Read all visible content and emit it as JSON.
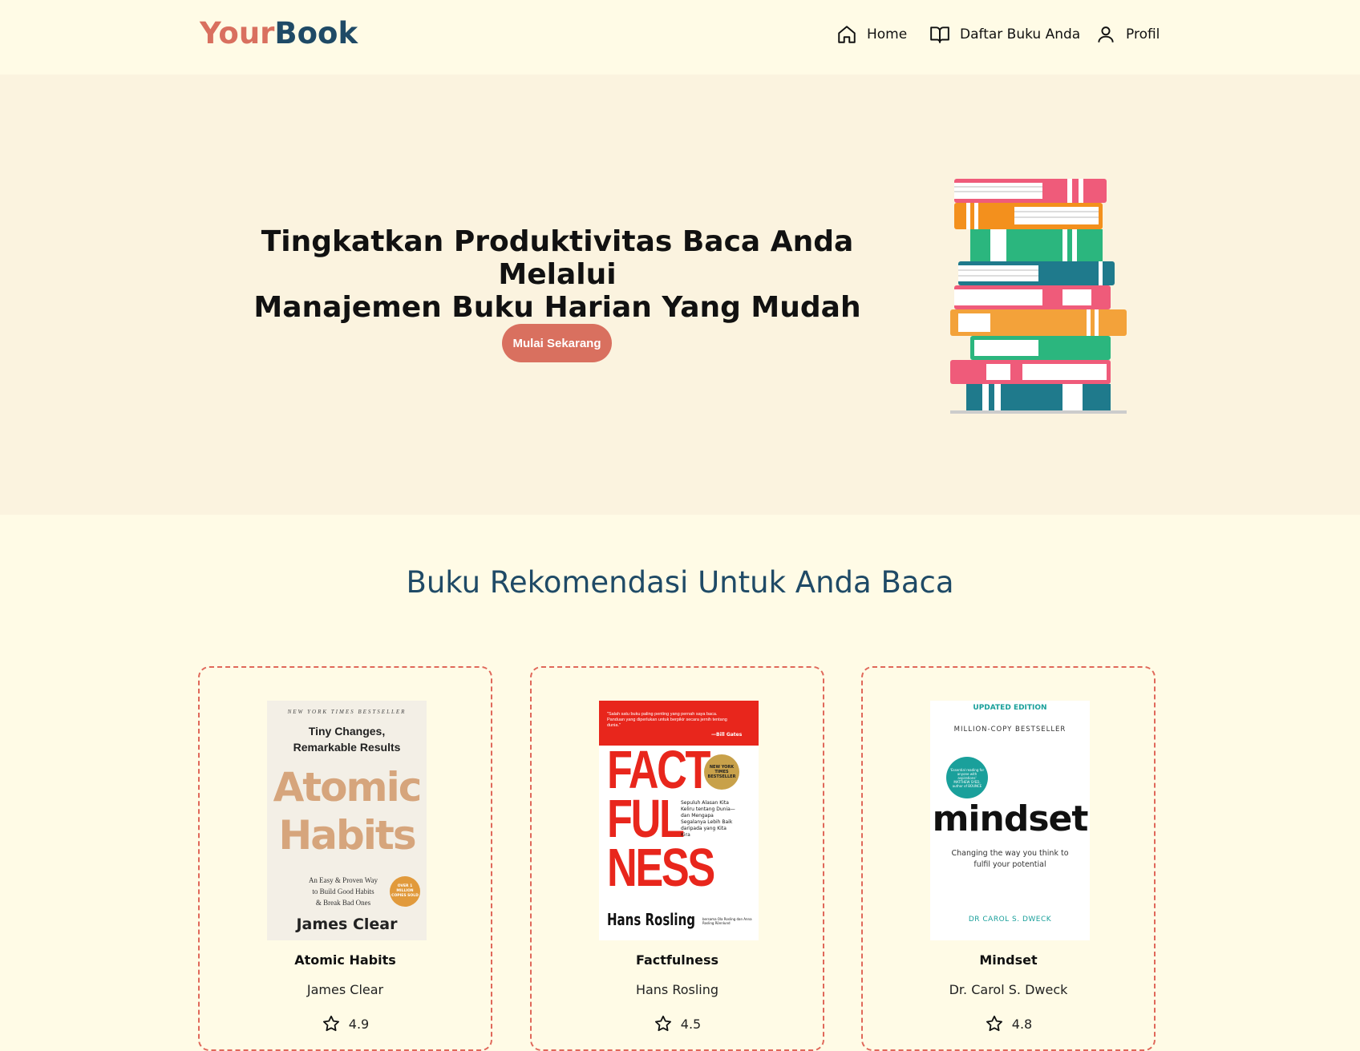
{
  "brand": {
    "part1": "Your",
    "part2": "Book"
  },
  "nav": {
    "items": [
      {
        "label": "Home",
        "icon": "home-icon"
      },
      {
        "label": "Daftar Buku Anda",
        "icon": "book-open-icon"
      },
      {
        "label": "Profil",
        "icon": "user-icon"
      }
    ]
  },
  "hero": {
    "title_line1": "Tingkatkan Produktivitas Baca Anda Melalui",
    "title_line2": "Manajemen Buku Harian Yang Mudah",
    "cta": "Mulai Sekarang"
  },
  "recommend": {
    "title": "Buku Rekomendasi Untuk Anda Baca",
    "books": [
      {
        "title": "Atomic Habits",
        "author": "James Clear",
        "rating": "4.9",
        "cover": {
          "top": "NEW YORK TIMES BESTSELLER",
          "sub1": "Tiny Changes,",
          "sub2": "Remarkable Results",
          "word1": "Atomic",
          "word2": "Habits",
          "tag1": "An Easy & Proven Way",
          "tag2": "to Build Good Habits",
          "tag3": "& Break Bad Ones",
          "badge": "OVER 1 MILLION COPIES SOLD",
          "author": "James Clear"
        }
      },
      {
        "title": "Factfulness",
        "author": "Hans Rosling",
        "rating": "4.5",
        "cover": {
          "quote": "\"Salah satu buku paling penting yang pernah saya baca. Panduan yang diperlukan untuk berpikir secara jernih tentang dunia.\"",
          "quote_by": "—Bill Gates",
          "l1": "FACT",
          "l2": "FUL",
          "l3": "NESS",
          "badge": "NEW YORK TIMES BESTSELLER",
          "desc": "Sepuluh Alasan Kita Keliru tentang Dunia—dan Mengapa Segalanya Lebih Baik daripada yang Kita Kira",
          "author": "Hans Rosling",
          "coauthors": "bersama Ola Rosling dan Anna Rosling Rönnlund"
        }
      },
      {
        "title": "Mindset",
        "author": "Dr. Carol S. Dweck",
        "rating": "4.8",
        "cover": {
          "edition": "UPDATED EDITION",
          "bestseller": "MILLION-COPY BESTSELLER",
          "badge": "'Essential reading for anyone with aspirations' MATTHEW SYED, author of BOUNCE",
          "word": "mindset",
          "tag1": "Changing the way you think to",
          "tag2": "fulfil your potential",
          "author": "DR CAROL S. DWECK"
        }
      }
    ]
  },
  "colors": {
    "accent": "#d9705f",
    "navy": "#1f4a66",
    "bg": "#fffbe6",
    "hero_bg": "#fbf3df"
  }
}
